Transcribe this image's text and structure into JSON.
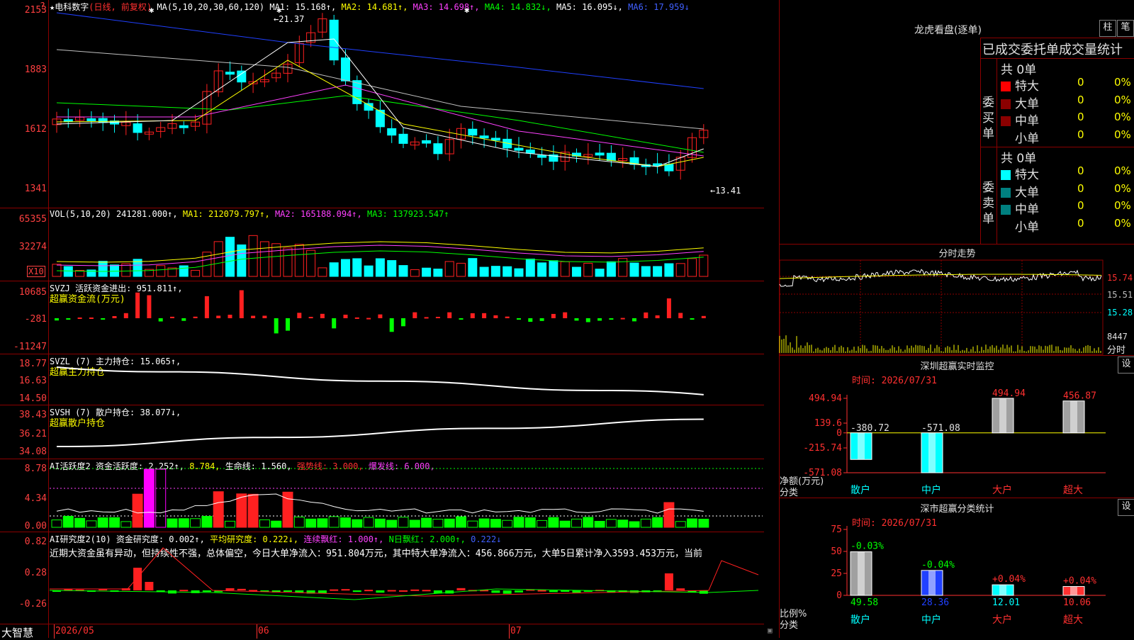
{
  "colors": {
    "up": "#ff2020",
    "down": "#00ffff",
    "ma1": "#ffffff",
    "ma2": "#ffff00",
    "ma3": "#ff40ff",
    "ma4": "#00ff00",
    "ma5": "#c0c0c0",
    "ma6": "#2040ff",
    "grid": "#8b0000"
  },
  "price": {
    "header": {
      "star": "★",
      "name": "电科数字",
      "mode": "(日线, 前复权)",
      "ma_params": "MA(5,10,20,30,60,120)",
      "ma1": "MA1: 15.168↑,",
      "ma2": "MA2: 14.681↑,",
      "ma3": "MA3: 14.698↑,",
      "ma4": "MA4: 14.832↓,",
      "ma5": "MA5: 16.095↓,",
      "ma6": "MA6: 17.959↓"
    },
    "top_badge": "?",
    "axis": [
      "2153",
      "1883",
      "1612",
      "1341"
    ],
    "hi_label": "←21.37",
    "lo_label": "←13.41"
  },
  "vol": {
    "header": {
      "name": "VOL(5,10,20)",
      "v": "241281.000↑,",
      "ma1": "MA1: 212079.797↑,",
      "ma2": "MA2: 165188.094↑,",
      "ma3": "MA3: 137923.547↑"
    },
    "axis": [
      "65355",
      "32274"
    ],
    "unit": "X10"
  },
  "svzj": {
    "header": {
      "name": "SVZJ",
      "t1": "活跃资金进出: 951.811↑,",
      "t2": "超赢资金流(万元)"
    },
    "axis": [
      "10685",
      "-281",
      "-11247"
    ]
  },
  "svzl": {
    "header": {
      "name": "SVZL (7)",
      "t1": "主力持仓: 15.065↑,",
      "t2": "超赢主力持仓"
    },
    "axis": [
      "18.77",
      "16.63",
      "14.50"
    ]
  },
  "svsh": {
    "header": {
      "name": "SVSH (7)",
      "t1": "散户持仓: 38.077↓,",
      "t2": "超赢散户持仓"
    },
    "axis": [
      "38.43",
      "36.21",
      "34.08"
    ]
  },
  "ai1": {
    "header": {
      "name": "AI活跃度2",
      "t1": "资金活跃度: 2.252↑,",
      "t2": "8.784,",
      "t3": "生命线: 1.560,",
      "t4": "强势线: 3.000,",
      "t5": "爆发线: 6.000,"
    },
    "axis": [
      "8.78",
      "4.34",
      "0.00"
    ]
  },
  "ai2": {
    "header": {
      "name": "AI研究度2(10)",
      "t1": "资金研究度: 0.002↑,",
      "t2": "平均研究度: 0.222↓,",
      "t3": "连续飘红: 1.000↑,",
      "t4": "N日飘红: 2.000↑,",
      "t5": "0.222↓"
    },
    "comment": "近期大资金虽有异动，但持续性不强，总体偏空，今日大单净流入：951.804万元，其中特大单净流入：456.866万元，大单5日累计净入3593.453万元，当前",
    "axis": [
      "0.82",
      "0.28",
      "-0.26"
    ]
  },
  "bottom": {
    "brand": "大智慧",
    "dates": [
      "2026/05",
      "06",
      "07"
    ]
  },
  "right": {
    "buttons": [
      "柱",
      "笔"
    ],
    "lhb_title": "龙虎看盘(逐单)",
    "stats_title": "已成交委托单成交量统计",
    "buy": {
      "side": "委买单",
      "total": "共 0单",
      "rows": [
        {
          "label": "特大",
          "v": "0",
          "p": "0%",
          "c": "#ff0000"
        },
        {
          "label": "大单",
          "v": "0",
          "p": "0%",
          "c": "#8b0000"
        },
        {
          "label": "中单",
          "v": "0",
          "p": "0%",
          "c": "#8b0000"
        },
        {
          "label": "小单",
          "v": "0",
          "p": "0%",
          "c": ""
        }
      ]
    },
    "sell": {
      "side": "委卖单",
      "total": "共 0单",
      "rows": [
        {
          "label": "特大",
          "v": "0",
          "p": "0%",
          "c": "#00ffff"
        },
        {
          "label": "大单",
          "v": "0",
          "p": "0%",
          "c": "#008080"
        },
        {
          "label": "中单",
          "v": "0",
          "p": "0%",
          "c": "#008080"
        },
        {
          "label": "小单",
          "v": "0",
          "p": "0%",
          "c": ""
        }
      ]
    },
    "intraday": {
      "title": "分时走势",
      "axis": [
        "15.74",
        "15.51",
        "15.28"
      ],
      "vol": "8447",
      "foot": "分时"
    },
    "sz": {
      "title": "深圳超赢实时监控",
      "btn": "设",
      "time": "时间: 2026/07/31",
      "axis": [
        "494.94",
        "139.6",
        "0",
        "-215.74",
        "-571.08"
      ],
      "ylabel": "净额(万元)",
      "xlabel": "分类",
      "chart_data": {
        "type": "bar",
        "categories": [
          "散户",
          "中户",
          "大户",
          "超大"
        ],
        "values": [
          -380.72,
          -571.08,
          494.94,
          456.87
        ],
        "labels": [
          "-380.72",
          "-571.08",
          "494.94",
          "456.87"
        ],
        "ylim": [
          -571.08,
          494.94
        ]
      }
    },
    "cls": {
      "title": "深市超赢分类统计",
      "btn": "设",
      "time": "时间: 2026/07/31",
      "axis": [
        "75",
        "50",
        "25",
        "0"
      ],
      "ylabel": "比例%",
      "xlabel": "分类",
      "chart_data": {
        "type": "bar",
        "categories": [
          "散户",
          "中户",
          "大户",
          "超大"
        ],
        "values": [
          49.58,
          28.36,
          12.01,
          10.06
        ],
        "changes": [
          "-0.03%",
          "-0.04%",
          "+0.04%",
          "+0.04%"
        ],
        "ylim": [
          0,
          75
        ]
      }
    }
  }
}
